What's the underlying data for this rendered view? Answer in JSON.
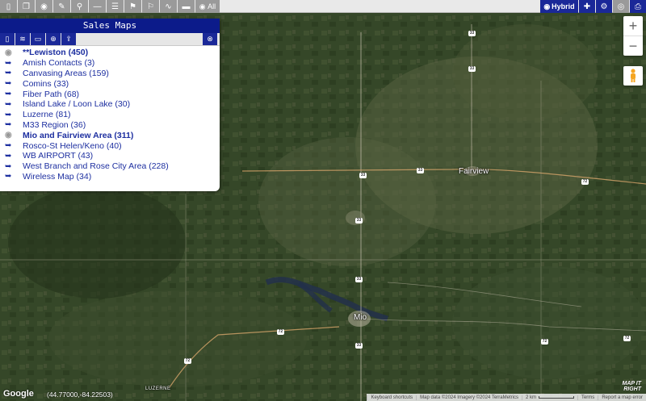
{
  "toolbar": {
    "left_buttons": [
      {
        "icon": "file-icon",
        "glyph": "▯"
      },
      {
        "icon": "copy-icon",
        "glyph": "❐"
      },
      {
        "icon": "view-icon",
        "glyph": "◉"
      },
      {
        "icon": "edit-icon",
        "glyph": "✎"
      },
      {
        "icon": "pin-icon",
        "glyph": "⚲"
      },
      {
        "icon": "line-icon",
        "glyph": "—"
      },
      {
        "icon": "list-icon",
        "glyph": "☰"
      },
      {
        "icon": "flag-icon",
        "glyph": "⚑"
      },
      {
        "icon": "flag-outline-icon",
        "glyph": "⚐"
      },
      {
        "icon": "route-icon",
        "glyph": "∿"
      },
      {
        "icon": "ruler-icon",
        "glyph": "▬"
      }
    ],
    "all_label": "All",
    "hybrid_label": "Hybrid",
    "right_icons": [
      "plus-icon",
      "gear-icon",
      "account-icon",
      "print-icon"
    ]
  },
  "panel": {
    "title": "Sales Maps",
    "tools": [
      "new-map-icon",
      "layers-icon",
      "folder-icon",
      "add-icon",
      "upload-icon"
    ],
    "items": [
      {
        "label": "**Lewiston (450)",
        "active": true
      },
      {
        "label": "Amish Contacts (3)",
        "active": false
      },
      {
        "label": "Canvasing Areas (159)",
        "active": false
      },
      {
        "label": "Comins (33)",
        "active": false
      },
      {
        "label": "Fiber Path (68)",
        "active": false
      },
      {
        "label": "Island Lake / Loon Lake (30)",
        "active": false
      },
      {
        "label": "Luzerne (81)",
        "active": false
      },
      {
        "label": "M33 Region (36)",
        "active": false
      },
      {
        "label": "Mio and Fairview Area (311)",
        "active": true
      },
      {
        "label": "Rosco-St Helen/Keno (40)",
        "active": false
      },
      {
        "label": "WB AIRPORT (43)",
        "active": false
      },
      {
        "label": "West Branch and Rose City Area (228)",
        "active": false
      },
      {
        "label": "Wireless Map (34)",
        "active": false
      }
    ]
  },
  "map": {
    "towns": {
      "fairview": "Fairview",
      "mio": "Mio",
      "luzerne": "LUZERNE"
    },
    "shields": [
      "33",
      "33",
      "33",
      "33",
      "33",
      "33",
      "72",
      "72",
      "72",
      "72",
      "72",
      "33"
    ],
    "google": "Google",
    "coords": "(44.77000,-84.22503)",
    "attribution": {
      "shortcuts": "Keyboard shortcuts",
      "data": "Map data ©2024 Imagery ©2024 TerraMetrics",
      "scale": "2 km",
      "terms": "Terms",
      "report": "Report a map error"
    },
    "brand_line1": "MAP IT",
    "brand_line2": "RIGHT"
  },
  "colors": {
    "toolbar_blue": "#1a2898",
    "panel_title": "#0c1b8a",
    "link": "#1d2fa0"
  }
}
